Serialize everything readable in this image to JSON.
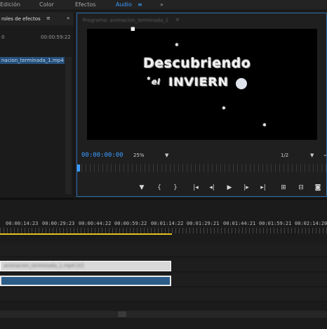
{
  "workspaces": {
    "edicion": "Edición",
    "color": "Color",
    "efectos": "Efectos",
    "audio": "Audio",
    "audio_menu_icon": "≡",
    "more": "»"
  },
  "effect_controls": {
    "tab_label": "roles de efectos",
    "tab_menu_icon": "≡",
    "more": "»",
    "start_time": "0",
    "end_time": "00:00:59:22",
    "clip_name": "nacion_terminada_1.mp4"
  },
  "program_monitor": {
    "tab_label": "Programa: animacion_terminada_1",
    "tab_menu_icon": "≡",
    "title_line1": "Descubriendo",
    "title_line2_prefix": "el",
    "title_line2_main": "INVIERN",
    "timecode": "00:00:00:00",
    "zoom": "25%",
    "resolution": "1/2"
  },
  "timeline": {
    "ruler_times": [
      "00:00:14:23",
      "00:00:29:23",
      "00:00:44:22",
      "00:00:59:22",
      "00:01:14:22",
      "00:01:29:21",
      "00:01:44:21",
      "00:01:59:21",
      "00:02:14:20"
    ],
    "audio_clip_name": "animacion_terminada_1.mp4 [V]"
  }
}
